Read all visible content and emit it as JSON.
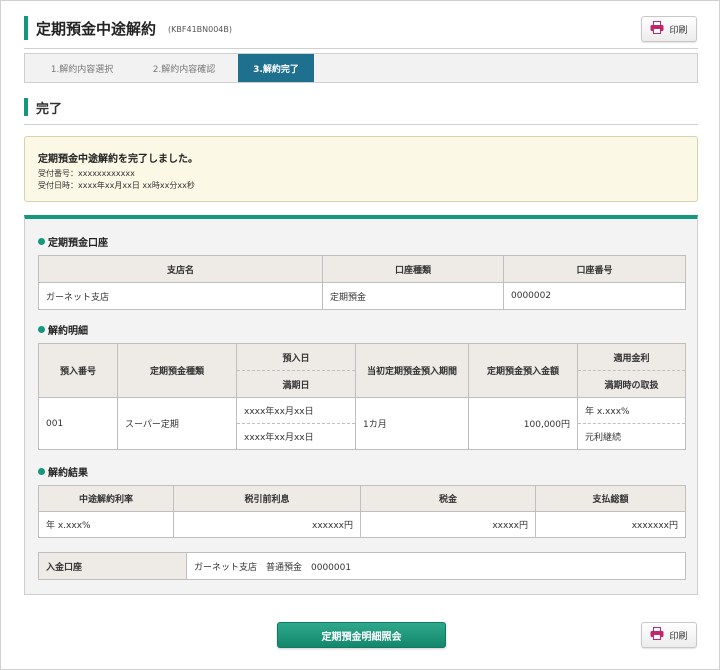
{
  "header": {
    "title": "定期預金中途解約",
    "screen_id": "(KBF41BN004B)",
    "print_label": "印刷"
  },
  "steps": [
    {
      "label": "1.解約内容選択"
    },
    {
      "label": "2.解約内容確認"
    },
    {
      "label": "3.解約完了",
      "active": true
    }
  ],
  "section": {
    "title": "完了"
  },
  "message": {
    "title": "定期預金中途解約を完了しました。",
    "receipt_number": "受付番号：xxxxxxxxxxxx",
    "receipt_datetime": "受付日時：xxxx年xx月xx日 xx時xx分xx秒"
  },
  "account": {
    "heading": "定期預金口座",
    "headers": [
      "支店名",
      "口座種類",
      "口座番号"
    ],
    "row": [
      "ガーネット支店",
      "定期預金",
      "0000002"
    ]
  },
  "details": {
    "heading": "解約明細",
    "headers": {
      "deposit_no": "預入番号",
      "type": "定期預金種類",
      "deposit_date": "預入日",
      "maturity_date": "満期日",
      "initial_period": "当初定期預金預入期間",
      "amount": "定期預金預入金額",
      "rate": "適用金利",
      "maturity_handling": "満期時の取扱"
    },
    "row": {
      "deposit_no": "001",
      "type": "スーパー定期",
      "deposit_date": "xxxx年xx月xx日",
      "maturity_date": "xxxx年xx月xx日",
      "initial_period": "1カ月",
      "amount": "100,000円",
      "rate": "年 x.xxx%",
      "maturity_handling": "元利継続"
    }
  },
  "result": {
    "heading": "解約結果",
    "headers": [
      "中途解約利率",
      "税引前利息",
      "税金",
      "支払総額"
    ],
    "row": [
      "年 x.xxx%",
      "xxxxxx円",
      "xxxxx円",
      "xxxxxxx円"
    ]
  },
  "deposit_account": {
    "label": "入金口座",
    "value": "ガーネット支店　普通預金　0000001"
  },
  "footer": {
    "main_button": "定期預金明細照会",
    "print_label": "印刷"
  },
  "colors": {
    "accent": "#13977d",
    "active_step": "#1f6f8f",
    "print_icon": "#c0266e",
    "message_bg": "#fbf8e6"
  }
}
